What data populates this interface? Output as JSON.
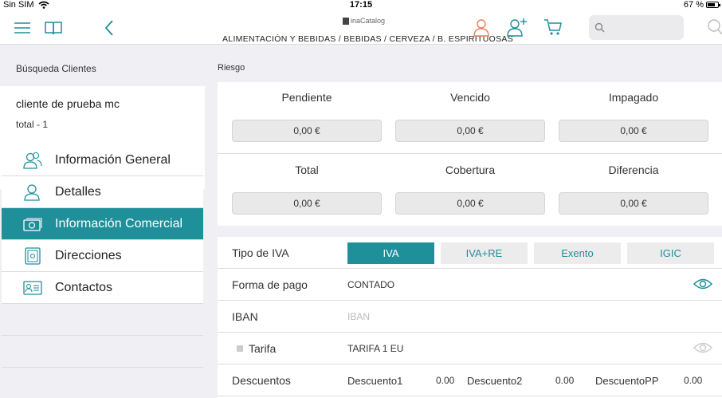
{
  "status": {
    "carrier": "Sin SIM",
    "time": "17:15",
    "battery": "67 %"
  },
  "toolbar": {
    "brand": "inaCatalog",
    "breadcrumb": "ALIMENTACIÓN Y BEBIDAS / BEBIDAS / CERVEZA / B. ESPIRITUOSAS",
    "search_placeholder": "",
    "icons": [
      "menu-icon",
      "book-icon",
      "back-chevron-icon",
      "user-icon",
      "add-user-icon",
      "cart-icon",
      "search-icon"
    ],
    "accent": "#1f8f9a",
    "user_icon_color": "#e8825a"
  },
  "sidebar": {
    "header": "Búsqueda Clientes",
    "client_name": "cliente de prueba mc",
    "client_total": "total - 1",
    "items": [
      {
        "label": "Información General",
        "icon": "users-icon"
      },
      {
        "label": "Detalles",
        "icon": "person-icon"
      },
      {
        "label": "Información Comercial",
        "icon": "money-icon"
      },
      {
        "label": "Direcciones",
        "icon": "safe-icon"
      },
      {
        "label": "Contactos",
        "icon": "contact-card-icon"
      }
    ],
    "active_item": "Información Comercial"
  },
  "risk": {
    "title": "Riesgo",
    "cells": [
      {
        "label": "Pendiente",
        "value": "0,00 €"
      },
      {
        "label": "Vencido",
        "value": "0,00 €"
      },
      {
        "label": "Impagado",
        "value": "0,00 €"
      },
      {
        "label": "Total",
        "value": "0,00 €"
      },
      {
        "label": "Cobertura",
        "value": "0,00 €"
      },
      {
        "label": "Diferencia",
        "value": "0,00 €"
      }
    ]
  },
  "form": {
    "tipo_iva_label": "Tipo de IVA",
    "iva_options": [
      "IVA",
      "IVA+RE",
      "Exento",
      "IGIC"
    ],
    "iva_selected": "IVA",
    "forma_pago_label": "Forma de pago",
    "forma_pago_value": "CONTADO",
    "iban_label": "IBAN",
    "iban_placeholder": "IBAN",
    "tarifa_label": "Tarifa",
    "tarifa_value": "TARIFA 1 EU",
    "descuentos_label": "Descuentos",
    "descuento1_label": "Descuento1",
    "descuento1_value": "0.00",
    "descuento2_label": "Descuento2",
    "descuento2_value": "0.00",
    "descuentopp_label": "DescuentoPP",
    "descuentopp_value": "0.00"
  }
}
